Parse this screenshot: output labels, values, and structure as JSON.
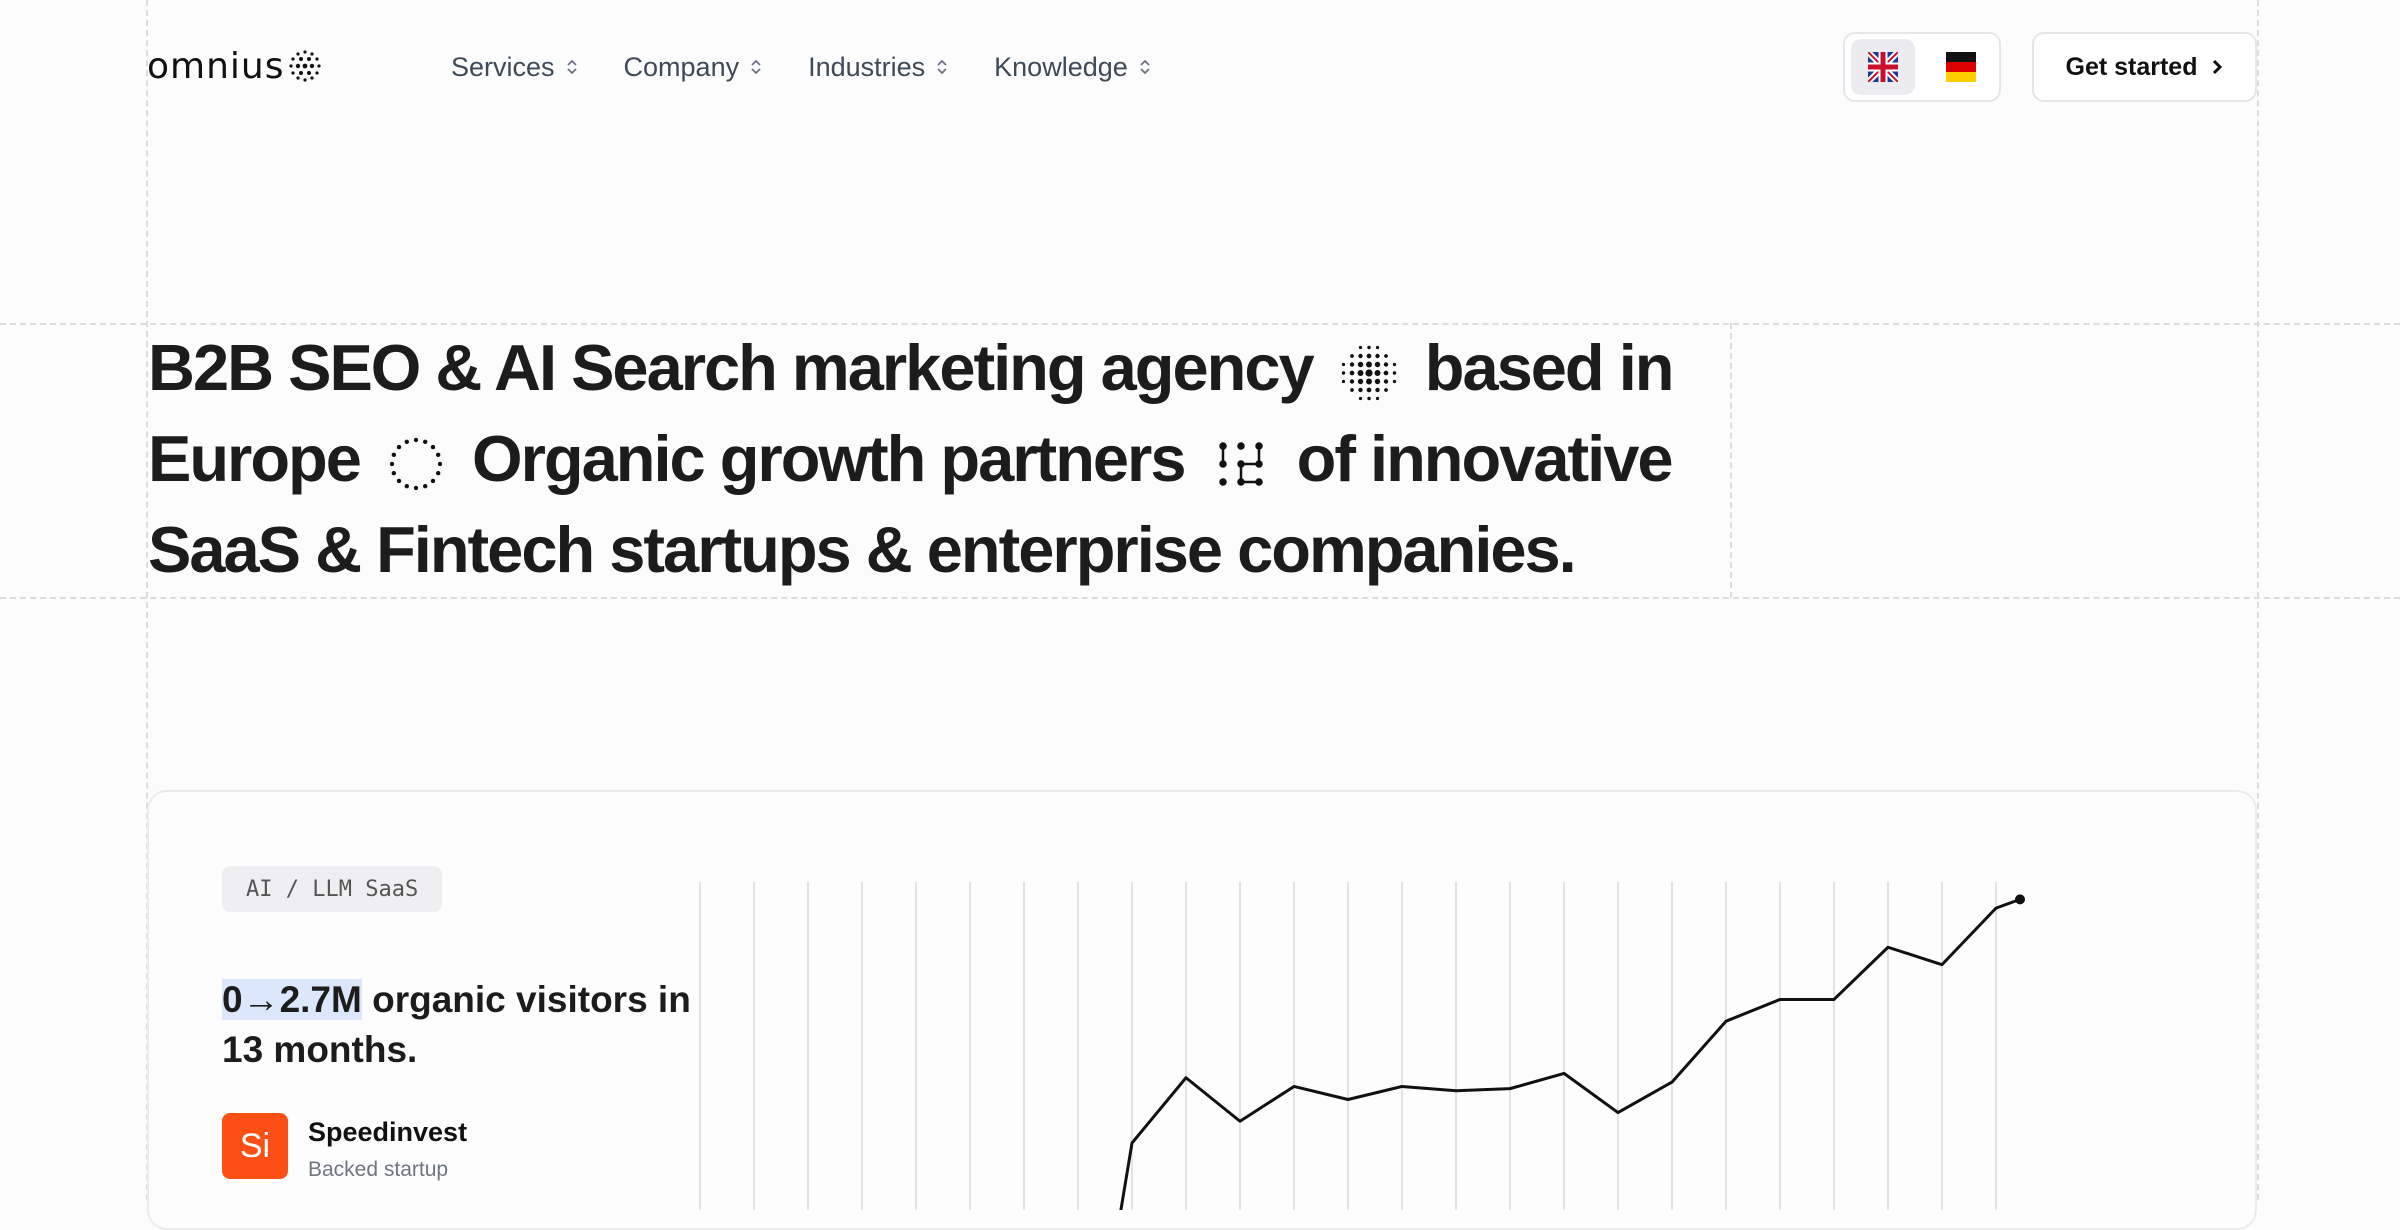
{
  "header": {
    "logo_text": "omnius",
    "nav": [
      {
        "label": "Services"
      },
      {
        "label": "Company"
      },
      {
        "label": "Industries"
      },
      {
        "label": "Knowledge"
      }
    ],
    "languages": [
      "english-flag",
      "german-flag"
    ],
    "active_language": "english-flag",
    "cta_label": "Get started"
  },
  "hero": {
    "part1": "B2B SEO & AI Search marketing agency",
    "part2": "based in Europe",
    "part3": "Organic growth partners",
    "part4": "of innovative SaaS & Fintech startups & enterprise companies."
  },
  "case": {
    "tag": "AI / LLM SaaS",
    "stat_highlight": "0→2.7M",
    "stat_rest": " organic visitors in 13 months.",
    "company_initials": "Si",
    "company_name": "Speedinvest",
    "company_sub": "Backed startup",
    "accent_color": "#fb4f14",
    "highlight_color": "#dde7fb"
  },
  "chart_data": {
    "type": "line",
    "title": "",
    "xlabel": "",
    "ylabel": "",
    "x": [
      1,
      2,
      3,
      4,
      5,
      6,
      7,
      8,
      9,
      10,
      11,
      12,
      13,
      14,
      15,
      16,
      17,
      18,
      19,
      20,
      21,
      22,
      23,
      24,
      25
    ],
    "values": [
      null,
      null,
      null,
      null,
      null,
      null,
      null,
      null,
      -10,
      5,
      -5,
      3,
      0,
      3,
      2,
      2.5,
      6,
      -3,
      4,
      18,
      23,
      23,
      35,
      31,
      44
    ],
    "series_last_point": 46,
    "ylim": [
      -30,
      50
    ],
    "grid": "vertical"
  }
}
